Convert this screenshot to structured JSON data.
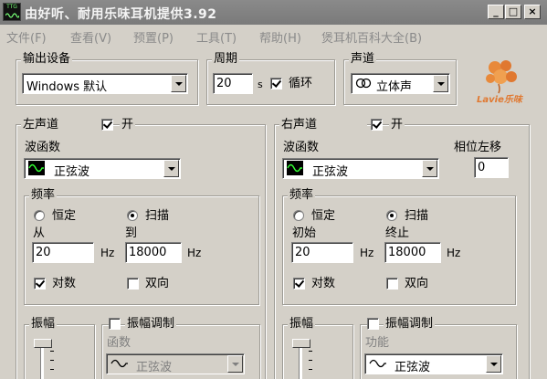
{
  "window": {
    "title": "由好听、耐用乐味耳机提供3.92",
    "app_icon_text": "TTG",
    "minimize": "_",
    "maximize": "□",
    "close": "×"
  },
  "menu": [
    {
      "label": "文件(F)"
    },
    {
      "label": "查看(V)"
    },
    {
      "label": "预置(P)"
    },
    {
      "label": "工具(T)"
    },
    {
      "label": "帮助(H)"
    },
    {
      "label": "煲耳机百科大全(B)"
    }
  ],
  "output": {
    "group_label": "输出设备",
    "device": "Windows 默认"
  },
  "period": {
    "group_label": "周期",
    "value": "20",
    "unit": "s",
    "loop_label": "循环",
    "loop_checked": true
  },
  "channel": {
    "group_label": "声道",
    "value": "立体声",
    "icon": "stereo-rings-icon"
  },
  "logo": {
    "text": "Lavie乐味",
    "color": "#e07830"
  },
  "left": {
    "group_label": "左声道",
    "on_label": "开",
    "on_checked": true,
    "waveform_label": "波函数",
    "waveform": "正弦波",
    "freq_label": "频率",
    "fixed_label": "恒定",
    "sweep_label": "扫描",
    "sweep_selected": true,
    "from_label": "从",
    "to_label": "到",
    "from_value": "20",
    "to_value": "18000",
    "unit": "Hz",
    "log_label": "对数",
    "log_checked": true,
    "bidir_label": "双向",
    "bidir_checked": false,
    "amp_label": "振幅",
    "am_label": "振幅调制",
    "am_checked": false,
    "am_func_label": "函数",
    "am_func": "正弦波"
  },
  "right": {
    "group_label": "右声道",
    "on_label": "开",
    "on_checked": true,
    "waveform_label": "波函数",
    "waveform": "正弦波",
    "phase_label": "相位左移",
    "phase_value": "0",
    "freq_label": "频率",
    "fixed_label": "恒定",
    "sweep_label": "扫描",
    "sweep_selected": true,
    "from_label": "初始",
    "to_label": "终止",
    "from_value": "20",
    "to_value": "18000",
    "unit": "Hz",
    "log_label": "对数",
    "log_checked": true,
    "bidir_label": "双向",
    "bidir_checked": false,
    "amp_label": "振幅",
    "am_label": "振幅调制",
    "am_checked": false,
    "am_func_label": "功能",
    "am_func": "正弦波"
  }
}
